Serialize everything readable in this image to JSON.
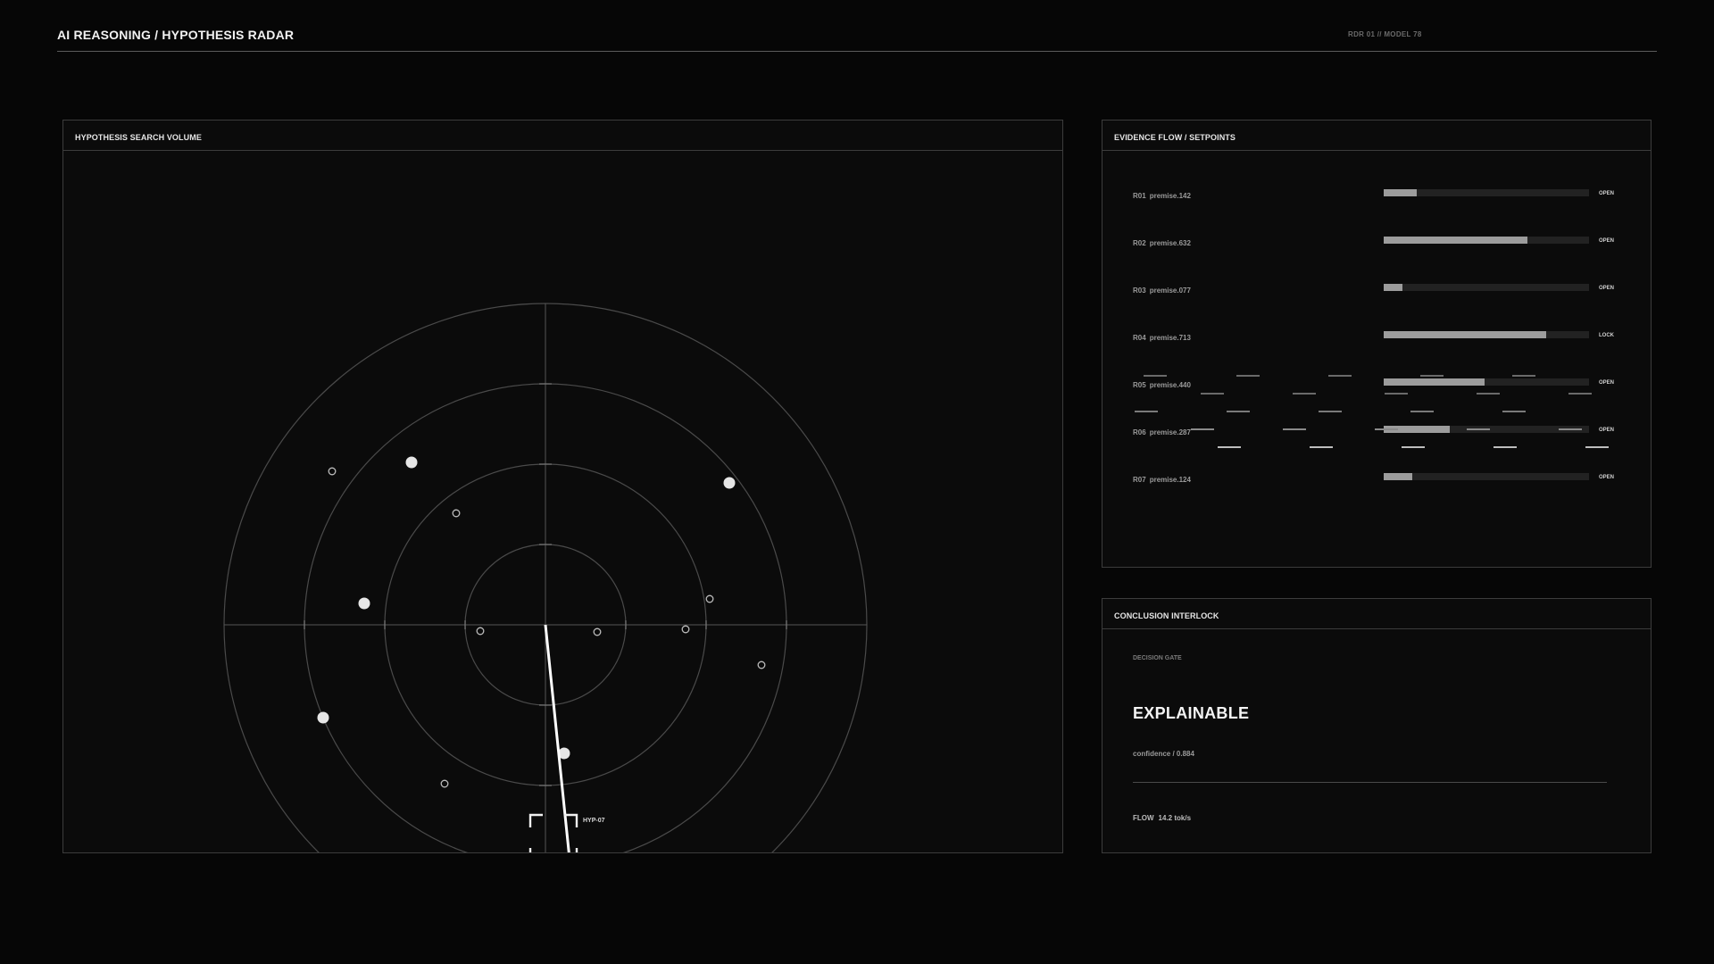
{
  "header": {
    "title": "AI REASONING / HYPOTHESIS RADAR",
    "meta": "RDR 01 // MODEL 78"
  },
  "radar": {
    "title": "HYPOTHESIS SEARCH VOLUME",
    "target_label": "HYP-07",
    "colors": {
      "ring": "#4a4a4a",
      "sweep": "#ffffff",
      "contact": "#e6e6e6"
    }
  },
  "evidence": {
    "title": "EVIDENCE FLOW / SETPOINTS",
    "rows": [
      {
        "id": "R01",
        "premise": "premise.142",
        "fill": 0.16,
        "state": "OPEN"
      },
      {
        "id": "R02",
        "premise": "premise.632",
        "fill": 0.7,
        "state": "OPEN"
      },
      {
        "id": "R03",
        "premise": "premise.077",
        "fill": 0.09,
        "state": "OPEN"
      },
      {
        "id": "R04",
        "premise": "premise.713",
        "fill": 0.79,
        "state": "LOCK"
      },
      {
        "id": "R05",
        "premise": "premise.440",
        "fill": 0.49,
        "state": "OPEN"
      },
      {
        "id": "R06",
        "premise": "premise.287",
        "fill": 0.32,
        "state": "OPEN"
      },
      {
        "id": "R07",
        "premise": "premise.124",
        "fill": 0.14,
        "state": "OPEN"
      }
    ]
  },
  "interlock": {
    "title": "CONCLUSION INTERLOCK",
    "gate_label": "DECISION GATE",
    "gate_value": "EXPLAINABLE",
    "confidence": "confidence / 0.884",
    "flow_label": "FLOW",
    "flow_value": "14.2 tok/s"
  }
}
